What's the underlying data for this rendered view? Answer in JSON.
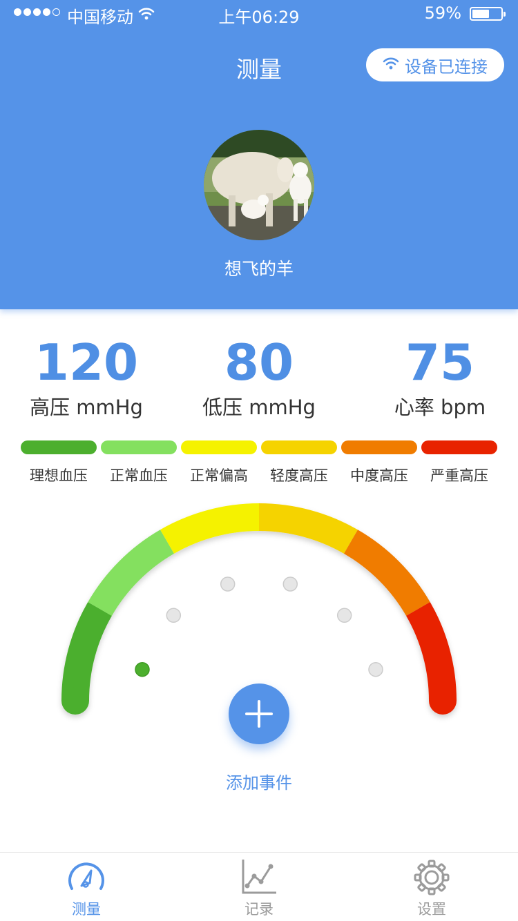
{
  "status_bar": {
    "carrier": "中国移动",
    "time": "上午06:29",
    "battery": "59%",
    "battery_level": 0.59
  },
  "header": {
    "title": "测量",
    "device_status": "设备已连接"
  },
  "profile": {
    "name": "想飞的羊"
  },
  "readings": {
    "systolic": {
      "value": "120",
      "label": "高压 mmHg"
    },
    "diastolic": {
      "value": "80",
      "label": "低压 mmHg"
    },
    "pulse": {
      "value": "75",
      "label": "心率 bpm"
    }
  },
  "scale": [
    {
      "label": "理想血压",
      "color": "#4caf2e"
    },
    {
      "label": "正常血压",
      "color": "#84e05f"
    },
    {
      "label": "正常偏高",
      "color": "#f5f200"
    },
    {
      "label": "轻度高压",
      "color": "#f5d300"
    },
    {
      "label": "中度高压",
      "color": "#f07c00"
    },
    {
      "label": "严重高压",
      "color": "#e82300"
    }
  ],
  "gauge": {
    "active_level": 0
  },
  "action": {
    "add_event": "添加事件"
  },
  "tabs": {
    "measure": "测量",
    "records": "记录",
    "settings": "设置"
  },
  "colors": {
    "primary": "#5593e8",
    "tab_inactive": "#9b9b9b"
  }
}
